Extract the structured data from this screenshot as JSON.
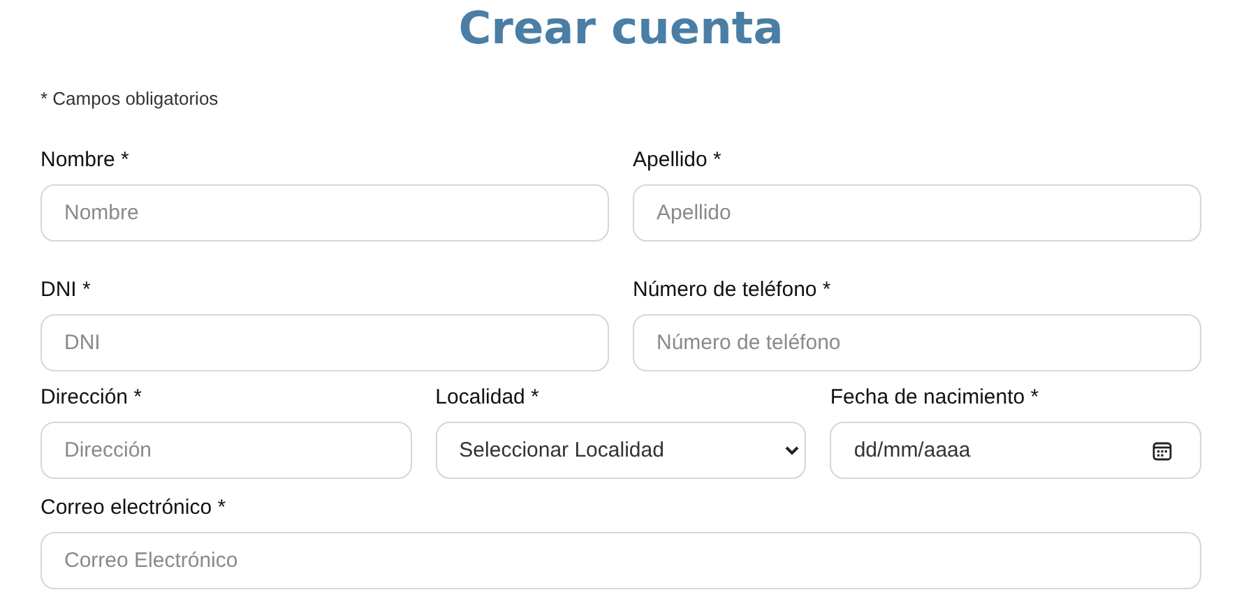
{
  "title": "Crear cuenta",
  "required_note": "* Campos obligatorios",
  "rows": [
    {
      "fields": [
        {
          "kind": "text",
          "label": "Nombre *",
          "placeholder": "Nombre"
        },
        {
          "kind": "text",
          "label": "Apellido *",
          "placeholder": "Apellido"
        }
      ]
    },
    {
      "fields": [
        {
          "kind": "text",
          "label": "DNI *",
          "placeholder": "DNI"
        },
        {
          "kind": "text",
          "label": "Número de teléfono *",
          "placeholder": "Número de teléfono"
        }
      ]
    },
    {
      "fields": [
        {
          "kind": "text",
          "label": "Dirección *",
          "placeholder": "Dirección"
        },
        {
          "kind": "select",
          "label": "Localidad *",
          "value": "Seleccionar Localidad"
        },
        {
          "kind": "date",
          "label": "Fecha de nacimiento *",
          "value": "dd/mm/aaaa"
        }
      ]
    },
    {
      "fields": [
        {
          "kind": "text",
          "label": "Correo electrónico *",
          "placeholder": "Correo Electrónico"
        }
      ]
    }
  ]
}
